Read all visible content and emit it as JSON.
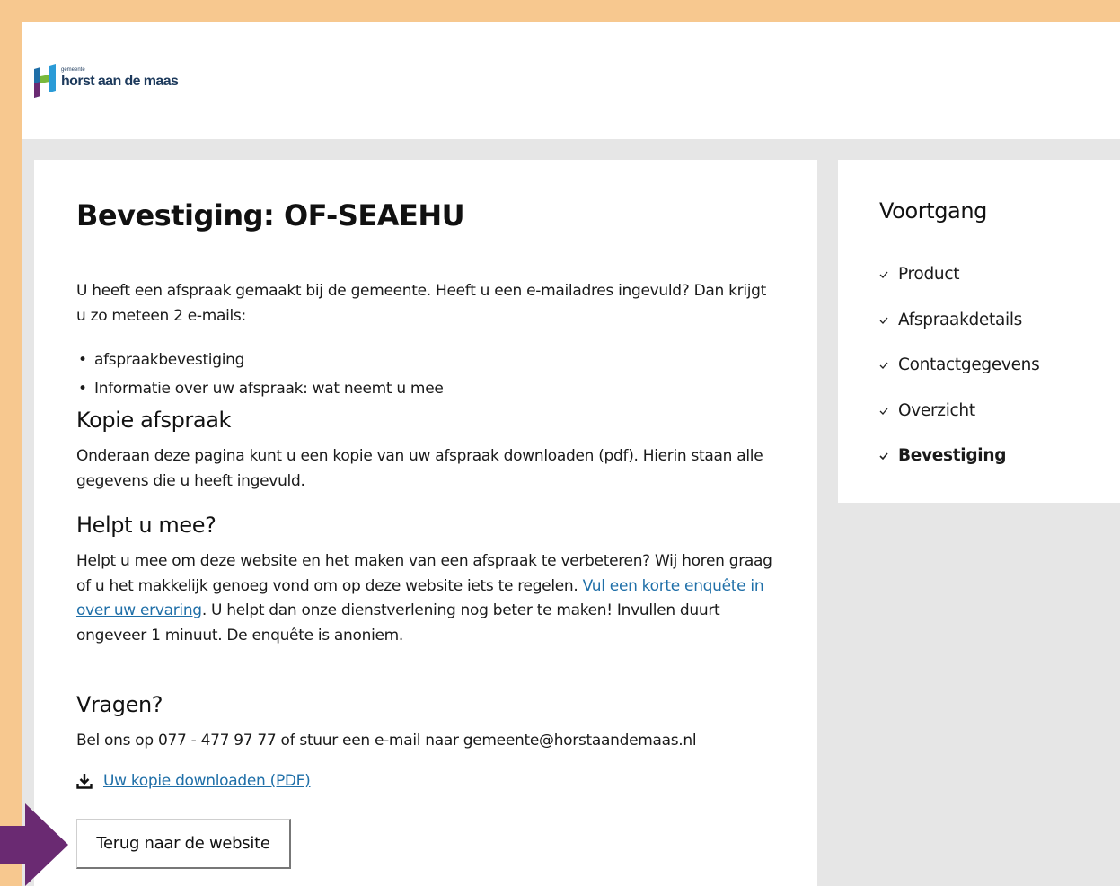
{
  "header": {
    "logo_small": "gemeente",
    "logo_text": "horst aan de maas"
  },
  "main": {
    "title": "Bevestiging: OF-SEAEHU",
    "intro": "U heeft een afspraak gemaakt bij de gemeente. Heeft u een e-mailadres ingevuld? Dan krijgt u zo meteen 2 e-mails:",
    "bullets": [
      "afspraakbevestiging",
      "Informatie over uw afspraak: wat neemt u mee"
    ],
    "kopie_heading": "Kopie afspraak",
    "kopie_text": "Onderaan deze pagina kunt u een kopie van uw afspraak downloaden (pdf). Hierin staan alle gegevens die u heeft ingevuld.",
    "helpt_heading": "Helpt u mee?",
    "helpt_text_before": "Helpt u mee om deze website en het maken van een afspraak te verbeteren? Wij horen graag of u het makkelijk genoeg vond om op deze website iets te regelen. ",
    "helpt_link": "Vul een korte enquête in over uw ervaring",
    "helpt_text_after": ". U helpt dan onze dienstverlening nog beter te maken! Invullen duurt ongeveer 1 minuut. De enquête is anoniem.",
    "vragen_heading": "Vragen?",
    "vragen_text": "Bel ons op 077 - 477 97 77 of stuur een e-mail naar gemeente@horstaandemaas.nl",
    "download_label": "Uw kopie downloaden (PDF)",
    "back_button": "Terug naar de website"
  },
  "sidebar": {
    "title": "Voortgang",
    "steps": [
      {
        "label": "Product",
        "active": false
      },
      {
        "label": "Afspraakdetails",
        "active": false
      },
      {
        "label": "Contactgegevens",
        "active": false
      },
      {
        "label": "Overzicht",
        "active": false
      },
      {
        "label": "Bevestiging",
        "active": true
      }
    ]
  },
  "icons": {
    "logo": "horst-logo-icon",
    "download": "download-icon",
    "check": "check-icon",
    "annotation": "arrow-right-icon"
  },
  "colors": {
    "frame": "#f7c88f",
    "link": "#1f6fa8",
    "arrow": "#6a2a72",
    "brand_blue": "#1d3a5c",
    "brand_green": "#79b93b"
  }
}
